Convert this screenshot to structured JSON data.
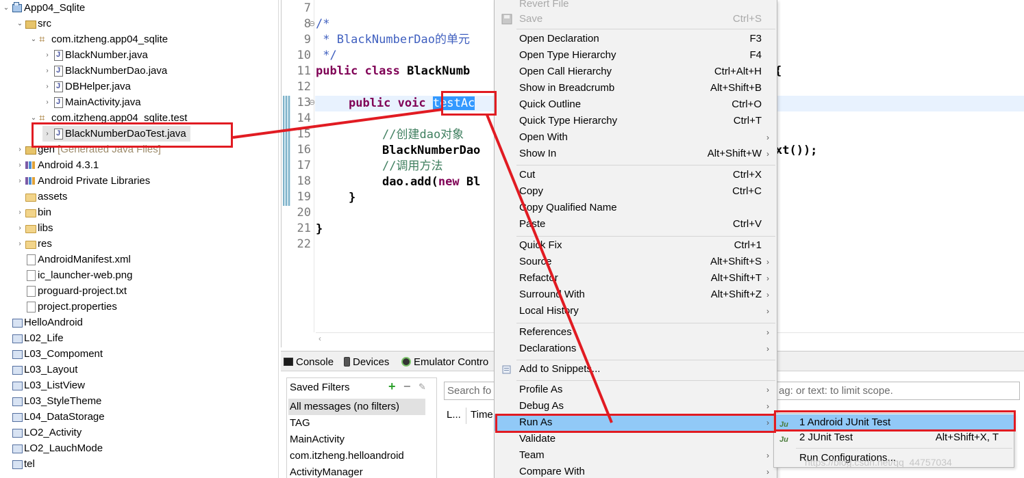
{
  "explorer": {
    "rows": [
      {
        "label": "App04_Sqlite",
        "twisty": "⌄",
        "icon": "project-icon"
      },
      {
        "label": "src",
        "twisty": "⌄",
        "icon": "source-folder-icon"
      },
      {
        "label": "com.itzheng.app04_sqlite",
        "twisty": "⌄",
        "icon": "package-icon"
      },
      {
        "label": "BlackNumber.java",
        "twisty": "›",
        "icon": "java-file-icon"
      },
      {
        "label": "BlackNumberDao.java",
        "twisty": "›",
        "icon": "java-file-icon"
      },
      {
        "label": "DBHelper.java",
        "twisty": "›",
        "icon": "java-file-icon"
      },
      {
        "label": "MainActivity.java",
        "twisty": "›",
        "icon": "java-file-icon"
      },
      {
        "label": "com.itzheng.app04_sqlite.test",
        "twisty": "⌄",
        "icon": "package-icon"
      },
      {
        "label": "BlackNumberDaoTest.java",
        "twisty": "›",
        "icon": "java-file-icon"
      },
      {
        "label": "gen",
        "suffix": "[Generated Java Files]",
        "twisty": "›",
        "icon": "source-folder-icon"
      },
      {
        "label": "Android 4.3.1",
        "twisty": "›",
        "icon": "library-icon"
      },
      {
        "label": "Android Private Libraries",
        "twisty": "›",
        "icon": "library-icon"
      },
      {
        "label": "assets",
        "twisty": "",
        "icon": "folder-icon"
      },
      {
        "label": "bin",
        "twisty": "›",
        "icon": "folder-icon"
      },
      {
        "label": "libs",
        "twisty": "›",
        "icon": "folder-icon"
      },
      {
        "label": "res",
        "twisty": "›",
        "icon": "folder-icon"
      },
      {
        "label": "AndroidManifest.xml",
        "twisty": "",
        "icon": "xml-file-icon"
      },
      {
        "label": "ic_launcher-web.png",
        "twisty": "",
        "icon": "image-file-icon"
      },
      {
        "label": "proguard-project.txt",
        "twisty": "",
        "icon": "text-file-icon"
      },
      {
        "label": "project.properties",
        "twisty": "",
        "icon": "text-file-icon"
      },
      {
        "label": "HelloAndroid",
        "twisty": "",
        "icon": "closed-project-icon"
      },
      {
        "label": "L02_Life",
        "twisty": "",
        "icon": "closed-project-icon"
      },
      {
        "label": "L03_Compoment",
        "twisty": "",
        "icon": "closed-project-icon"
      },
      {
        "label": "L03_Layout",
        "twisty": "",
        "icon": "closed-project-icon"
      },
      {
        "label": "L03_ListView",
        "twisty": "",
        "icon": "closed-project-icon"
      },
      {
        "label": "L03_StyleTheme",
        "twisty": "",
        "icon": "closed-project-icon"
      },
      {
        "label": "L04_DataStorage",
        "twisty": "",
        "icon": "closed-project-icon"
      },
      {
        "label": "LO2_Activity",
        "twisty": "",
        "icon": "closed-project-icon"
      },
      {
        "label": "LO2_LauchMode",
        "twisty": "",
        "icon": "closed-project-icon"
      },
      {
        "label": "tel",
        "twisty": "",
        "icon": "closed-project-icon"
      }
    ]
  },
  "editor": {
    "line_numbers": [
      "7",
      "8",
      "9",
      "10",
      "11",
      "12",
      "13",
      "14",
      "15",
      "16",
      "17",
      "18",
      "19",
      "20",
      "21",
      "22"
    ],
    "l8": "/*",
    "l9": " * BlackNumberDao的单元",
    "l10": " */",
    "l11_kw1": "public",
    "l11_kw2": "class",
    "l11_name": "BlackNumb",
    "l11_tail": "{",
    "l13_kw1": "public",
    "l13_kw2": "voic",
    "l13_sel": "testAc",
    "l15": "//创建dao对象",
    "l16": "BlackNumberDao",
    "l16_tail": "xt());",
    "l17": "//调用方法",
    "l18_a": "dao.add(",
    "l18_kw": "new",
    "l18_b": " Bl",
    "l19": "}",
    "l21": "}",
    "scroll_left": "‹"
  },
  "console": {
    "tabs": [
      "Console",
      "Devices",
      "Emulator Contro"
    ],
    "saved_filters_label": "Saved Filters",
    "filters": [
      "All messages (no filters)",
      "TAG",
      "MainActivity",
      "com.itzheng.helloandroid",
      "ActivityManager"
    ],
    "search_placeholder": "Search fo",
    "scope_placeholder": "ag: or text: to limit scope.",
    "columns": [
      "L...",
      "Time"
    ]
  },
  "context_menu": {
    "revert": "Revert File",
    "save": {
      "label": "Save",
      "shortcut": "Ctrl+S"
    },
    "items_a": [
      {
        "label": "Open Declaration",
        "shortcut": "F3"
      },
      {
        "label": "Open Type Hierarchy",
        "shortcut": "F4"
      },
      {
        "label": "Open Call Hierarchy",
        "shortcut": "Ctrl+Alt+H"
      },
      {
        "label": "Show in Breadcrumb",
        "shortcut": "Alt+Shift+B"
      },
      {
        "label": "Quick Outline",
        "shortcut": "Ctrl+O"
      },
      {
        "label": "Quick Type Hierarchy",
        "shortcut": "Ctrl+T"
      },
      {
        "label": "Open With",
        "shortcut": ""
      },
      {
        "label": "Show In",
        "shortcut": "Alt+Shift+W"
      }
    ],
    "items_b": [
      {
        "label": "Cut",
        "shortcut": "Ctrl+X"
      },
      {
        "label": "Copy",
        "shortcut": "Ctrl+C"
      },
      {
        "label": "Copy Qualified Name",
        "shortcut": ""
      },
      {
        "label": "Paste",
        "shortcut": "Ctrl+V"
      }
    ],
    "items_c": [
      {
        "label": "Quick Fix",
        "shortcut": "Ctrl+1"
      },
      {
        "label": "Source",
        "shortcut": "Alt+Shift+S"
      },
      {
        "label": "Refactor",
        "shortcut": "Alt+Shift+T"
      },
      {
        "label": "Surround With",
        "shortcut": "Alt+Shift+Z"
      },
      {
        "label": "Local History",
        "shortcut": ""
      }
    ],
    "items_d": [
      {
        "label": "References",
        "shortcut": ""
      },
      {
        "label": "Declarations",
        "shortcut": ""
      }
    ],
    "snippets": "Add to Snippets...",
    "items_e": [
      {
        "label": "Profile As"
      },
      {
        "label": "Debug As"
      },
      {
        "label": "Run As"
      },
      {
        "label": "Validate"
      },
      {
        "label": "Team"
      },
      {
        "label": "Compare With"
      }
    ],
    "arrow": "›"
  },
  "submenu": {
    "items": [
      {
        "label": "1 Android JUnit Test",
        "shortcut": ""
      },
      {
        "label": "2 JUnit Test",
        "shortcut": "Alt+Shift+X, T"
      },
      {
        "label": "Run Configurations...",
        "shortcut": ""
      }
    ],
    "junit_glyph": "Ju"
  },
  "watermark": "https://blog.csdn.net/qq_44757034",
  "colors": {
    "highlight": "#91c9f7",
    "annotation_red": "#e11b22",
    "selection": "#3399ff"
  }
}
